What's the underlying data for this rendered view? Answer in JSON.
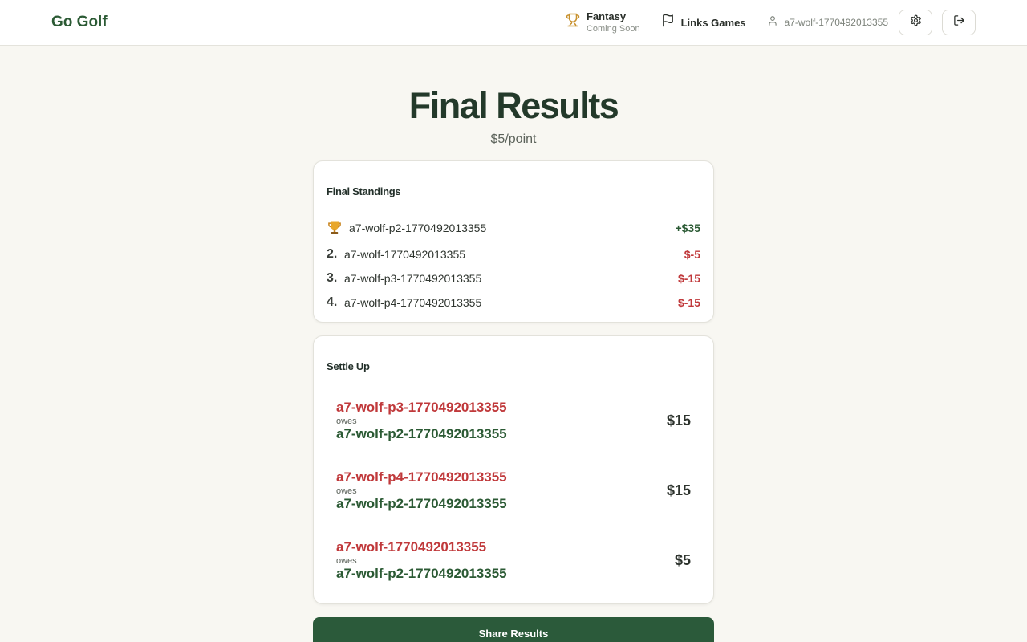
{
  "header": {
    "brand": "Go Golf",
    "fantasy_label": "Fantasy",
    "fantasy_sub": "Coming Soon",
    "links_label": "Links Games",
    "user_label": "a7-wolf-1770492013355"
  },
  "page": {
    "title": "Final Results",
    "subtitle": "$5/point"
  },
  "standings": {
    "title": "Final Standings",
    "rows": [
      {
        "rank": "",
        "name": "a7-wolf-p2-1770492013355",
        "amount": "+$35"
      },
      {
        "rank": "2.",
        "name": "a7-wolf-1770492013355",
        "amount": "$-5"
      },
      {
        "rank": "3.",
        "name": "a7-wolf-p3-1770492013355",
        "amount": "$-15"
      },
      {
        "rank": "4.",
        "name": "a7-wolf-p4-1770492013355",
        "amount": "$-15"
      }
    ]
  },
  "settle": {
    "title": "Settle Up",
    "debts": [
      {
        "from": "a7-wolf-p3-1770492013355",
        "owes": "owes",
        "to": "a7-wolf-p2-1770492013355",
        "amount": "$15"
      },
      {
        "from": "a7-wolf-p4-1770492013355",
        "owes": "owes",
        "to": "a7-wolf-p2-1770492013355",
        "amount": "$15"
      },
      {
        "from": "a7-wolf-1770492013355",
        "owes": "owes",
        "to": "a7-wolf-p2-1770492013355",
        "amount": "$5"
      }
    ]
  },
  "share_label": "Share Results",
  "colors": {
    "brand": "#2b5a34",
    "positive": "#2b5a34",
    "negative": "#c0393b",
    "trophy": "#c8912e"
  },
  "icons": {
    "fantasy": "trophy-icon",
    "links": "flag-icon",
    "user": "user-icon",
    "settings": "gear-icon",
    "logout": "logout-icon",
    "winner": "trophy-icon"
  }
}
